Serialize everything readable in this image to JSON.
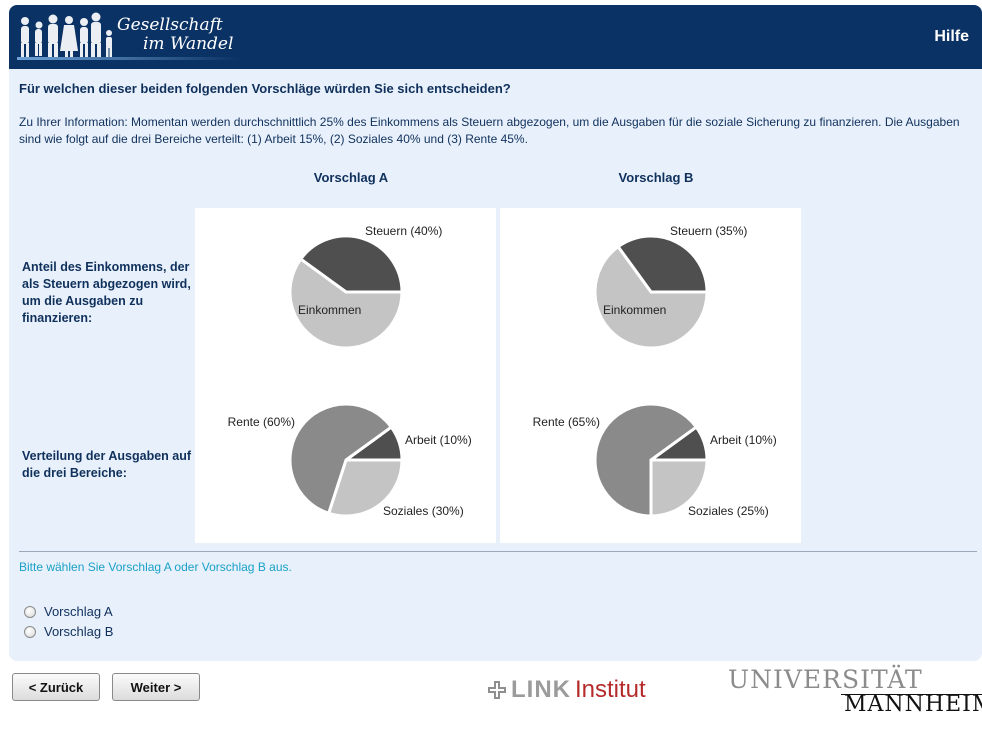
{
  "header": {
    "logo_line1": "Gesellschaft",
    "logo_line2": "im Wandel",
    "help_label": "Hilfe"
  },
  "survey": {
    "question": "Für welchen dieser beiden folgenden Vorschläge würden Sie sich entscheiden?",
    "info": "Zu Ihrer Information: Momentan werden durchschnittlich 25% des Einkommens als Steuern abgezogen, um die Ausgaben für die soziale Sicherung zu finanzieren. Die Ausgaben sind wie folgt auf die drei Bereiche verteilt: (1) Arbeit 15%, (2) Soziales 40% und (3) Rente 45%.",
    "col_a": "Vorschlag A",
    "col_b": "Vorschlag B",
    "row1_label": "Anteil des Einkommens, der als Steuern abgezogen wird, um die Ausgaben zu finanzieren:",
    "row2_label": "Verteilung der Ausgaben auf die drei Bereiche:",
    "prompt": "Bitte wählen Sie Vorschlag A oder Vorschlag B aus.",
    "options": [
      "Vorschlag A",
      "Vorschlag B"
    ]
  },
  "nav": {
    "back_label": "< Zurück",
    "next_label": "Weiter >"
  },
  "footer": {
    "link_brand": "LINK",
    "link_suffix": "Institut",
    "uni_line1": "UNIVERSITÄT",
    "uni_line2": "MANNHEIM"
  },
  "colors": {
    "header_bg": "#0b3264",
    "panel_bg": "#e8f1fb",
    "text": "#10305c",
    "prompt": "#1aa0c8",
    "slice_dark": "#4f4f4f",
    "slice_mid": "#8a8a8a",
    "slice_light": "#c4c4c4"
  },
  "chart_data": [
    {
      "type": "pie",
      "title": "Vorschlag A",
      "slices": [
        {
          "label": "Steuern (40%)",
          "value": 40
        },
        {
          "label": "Einkommen",
          "value": 60
        }
      ]
    },
    {
      "type": "pie",
      "title": "Vorschlag B",
      "slices": [
        {
          "label": "Steuern (35%)",
          "value": 35
        },
        {
          "label": "Einkommen",
          "value": 65
        }
      ]
    },
    {
      "type": "pie",
      "title": "Vorschlag A",
      "slices": [
        {
          "label": "Arbeit (10%)",
          "value": 10
        },
        {
          "label": "Soziales (30%)",
          "value": 30
        },
        {
          "label": "Rente (60%)",
          "value": 60
        }
      ]
    },
    {
      "type": "pie",
      "title": "Vorschlag B",
      "slices": [
        {
          "label": "Arbeit (10%)",
          "value": 10
        },
        {
          "label": "Soziales (25%)",
          "value": 25
        },
        {
          "label": "Rente (65%)",
          "value": 65
        }
      ]
    }
  ]
}
